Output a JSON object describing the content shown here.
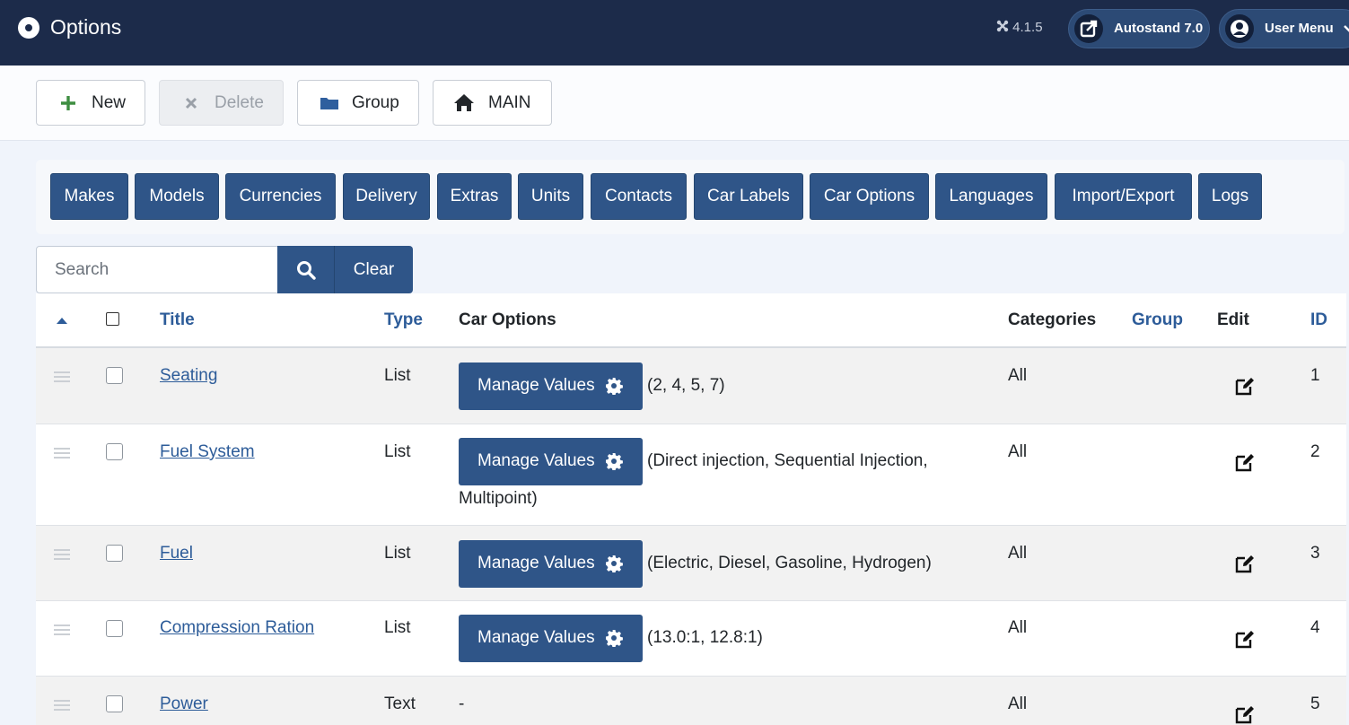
{
  "header": {
    "title": "Options",
    "version": "4.1.5",
    "site_label": "Autostand 7.0",
    "user_menu_label": "User Menu"
  },
  "toolbar": {
    "new_label": "New",
    "delete_label": "Delete",
    "group_label": "Group",
    "main_label": "MAIN"
  },
  "nav": [
    "Makes",
    "Models",
    "Currencies",
    "Delivery",
    "Extras",
    "Units",
    "Contacts",
    "Car Labels",
    "Car Options",
    "Languages",
    "Import/Export",
    "Logs"
  ],
  "search": {
    "placeholder": "Search",
    "clear_label": "Clear"
  },
  "table": {
    "headers": {
      "title": "Title",
      "type": "Type",
      "car_options": "Car Options",
      "categories": "Categories",
      "group": "Group",
      "edit": "Edit",
      "id": "ID"
    },
    "manage_label": "Manage Values",
    "rows": [
      {
        "title": "Seating",
        "type": "List",
        "values": "(2, 4, 5, 7)",
        "categories": "All",
        "id": "1"
      },
      {
        "title": "Fuel System",
        "type": "List",
        "values": "(Direct injection, Sequential Injection, Multipoint)",
        "categories": "All",
        "id": "2"
      },
      {
        "title": "Fuel",
        "type": "List",
        "values": "(Electric, Diesel, Gasoline, Hydrogen)",
        "categories": "All",
        "id": "3"
      },
      {
        "title": "Compression Ration",
        "type": "List",
        "values": "(13.0:1, 12.8:1)",
        "categories": "All",
        "id": "4"
      },
      {
        "title": "Power",
        "type": "Text",
        "values": "-",
        "categories": "All",
        "id": "5"
      }
    ]
  },
  "colors": {
    "header_bg": "#1c2b4a",
    "primary_button": "#2f5588",
    "link": "#2d5c99"
  }
}
